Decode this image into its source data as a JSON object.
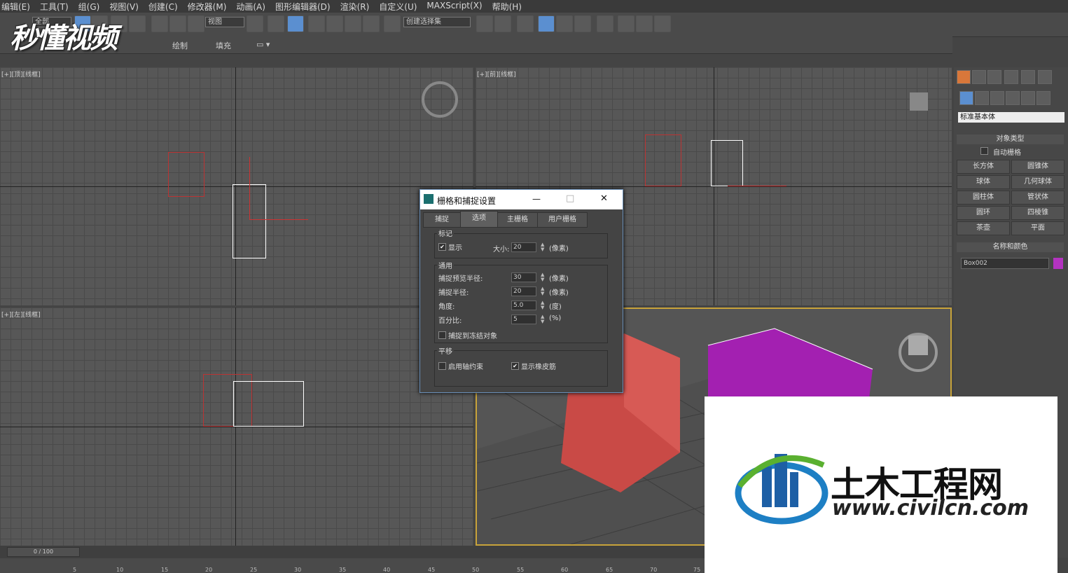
{
  "menu": [
    "编辑(E)",
    "工具(T)",
    "组(G)",
    "视图(V)",
    "创建(C)",
    "修改器(M)",
    "动画(A)",
    "图形编辑器(D)",
    "渲染(R)",
    "自定义(U)",
    "MAXScript(X)",
    "帮助(H)"
  ],
  "toolbar": {
    "select_filter": "全部",
    "ref_coord": "视图",
    "named_selection": "创建选择集"
  },
  "ribbon": {
    "item1": "绘制",
    "item2": "填充"
  },
  "viewports": {
    "top_left_label": "[+][顶][线框]",
    "top_right_label": "[+][前][线框]",
    "bottom_left_label": "[+][左][线框]"
  },
  "dialog": {
    "title": "栅格和捕捉设置",
    "minimize": "—",
    "maximize": "□",
    "close": "✕",
    "tabs": [
      "捕捉",
      "选项",
      "主栅格",
      "用户栅格"
    ],
    "active_tab": "选项",
    "marker": {
      "group": "标记",
      "show_label": "显示",
      "show_checked": "✔",
      "size_label": "大小:",
      "size_value": "20",
      "size_unit": "(像素)"
    },
    "general": {
      "group": "通用",
      "preview_radius_label": "捕捉预览半径:",
      "preview_radius_value": "30",
      "preview_radius_unit": "(像素)",
      "snap_radius_label": "捕捉半径:",
      "snap_radius_value": "20",
      "snap_radius_unit": "(像素)",
      "angle_label": "角度:",
      "angle_value": "5.0",
      "angle_unit": "(度)",
      "percent_label": "百分比:",
      "percent_value": "5",
      "percent_unit": "(%)",
      "frozen_label": "捕捉到冻结对象"
    },
    "translation": {
      "group": "平移",
      "axis_constraint_label": "启用轴约束",
      "rubber_band_label": "显示橡皮筋",
      "rubber_band_checked": "✔"
    }
  },
  "command_panel": {
    "category": "标准基本体",
    "object_type_title": "对象类型",
    "autogrid": "自动栅格",
    "buttons": [
      "长方体",
      "圆锥体",
      "球体",
      "几何球体",
      "圆柱体",
      "管状体",
      "圆环",
      "四棱锥",
      "茶壶",
      "平面"
    ],
    "name_color_title": "名称和颜色",
    "object_name": "Box002",
    "object_color": "#b333c0"
  },
  "timeline": {
    "frame": "0 / 100",
    "ticks": [
      "5",
      "10",
      "15",
      "20",
      "25",
      "30",
      "35",
      "40",
      "45",
      "50",
      "55",
      "60",
      "65",
      "70",
      "75"
    ]
  },
  "watermark_left": "秒懂视频",
  "watermark_right": {
    "title": "土木工程网",
    "url": "www.civilcn.com"
  },
  "colors": {
    "red_box": "#d4524e",
    "purple_box": "#a21fb0",
    "selection_blue": "#5b8fd0"
  }
}
